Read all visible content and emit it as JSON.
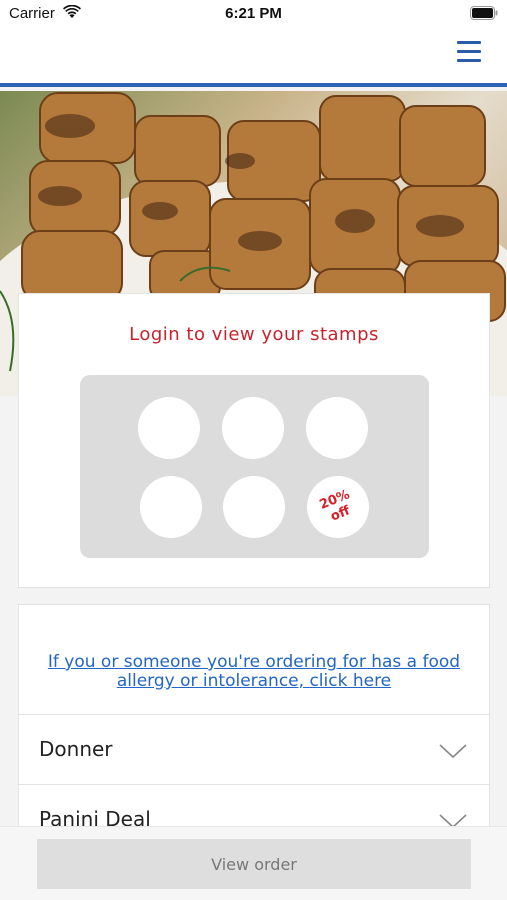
{
  "status_bar": {
    "carrier": "Carrier",
    "time": "6:21 PM"
  },
  "header": {
    "menu_icon": "hamburger-icon",
    "accent_color": "#2f63b4"
  },
  "hero": {
    "image": "grilled chicken skewers"
  },
  "stamps": {
    "title": "Login to view your stamps",
    "title_color": "#c8232c",
    "total": 6,
    "reward_label": "20%\noff"
  },
  "menu": {
    "allergy_link": "If you or someone you're ordering for has a food allergy or intolerance, click here",
    "categories": [
      {
        "label": "Donner"
      },
      {
        "label": "Panini Deal"
      }
    ]
  },
  "footer": {
    "view_order_label": "View order"
  }
}
